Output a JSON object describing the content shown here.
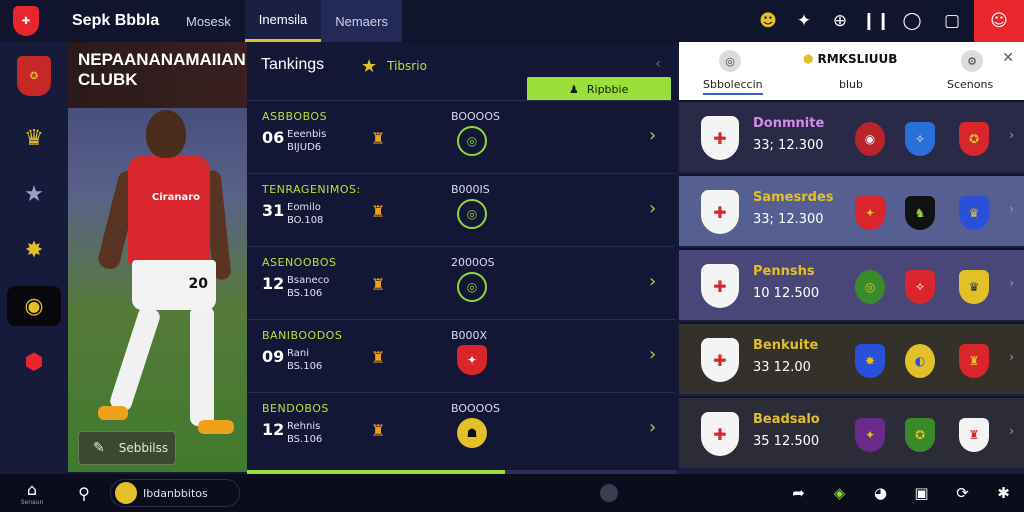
{
  "topbar": {
    "title": "Sepk Bbbla",
    "tabs": [
      {
        "label": "Mosesk"
      },
      {
        "label": "Inemsila"
      },
      {
        "label": "Nemaers"
      }
    ],
    "icons": [
      "smiley-icon",
      "pin-icon",
      "globe-icon",
      "pause-icon",
      "circle-icon",
      "square-icon",
      "profile-icon"
    ]
  },
  "rail": {
    "items": [
      "club-crest-icon",
      "trophy-icon",
      "star-icon",
      "badge-icon",
      "coin-icon",
      "shield-icon"
    ],
    "active_index": 4
  },
  "player": {
    "club_name": "NEPAANANAMAIIAN CLUBK",
    "shirt_sponsor": "Ciranaro",
    "shirt_number": "20",
    "button_label": "Sebbilss"
  },
  "rankings": {
    "title": "Tankings",
    "subtitle": "Tibsrio",
    "pill_label": "Ripbbie",
    "progress_fraction": 0.6,
    "rows": [
      {
        "name": "ASBBOBOS",
        "num": "06",
        "meta1": "Eeenbis",
        "meta2": "BIJUD6",
        "code": "BOOOOS",
        "crest": "green"
      },
      {
        "name": "TENRAGENIMOS:",
        "num": "31",
        "meta1": "Eomilo",
        "meta2": "BO.108",
        "code": "B000IS",
        "crest": "green"
      },
      {
        "name": "ASENOOBOS",
        "num": "12",
        "meta1": "Bsaneco",
        "meta2": "BS.106",
        "code": "2000OS",
        "crest": "green"
      },
      {
        "name": "BANIBOODOS",
        "num": "09",
        "meta1": "Rani",
        "meta2": "BS.106",
        "code": "B000X",
        "crest": "red"
      },
      {
        "name": "BENDOBOS",
        "num": "12",
        "meta1": "Rehnis",
        "meta2": "BS.106",
        "code": "BOOOOS",
        "crest": "yellow"
      }
    ]
  },
  "clubs": {
    "title": "RMKSLIUUB",
    "tabs": [
      {
        "label": "Sbboleccin"
      },
      {
        "label": "blub"
      },
      {
        "label": "Scenons"
      }
    ],
    "teams": [
      {
        "name": "Donmnite",
        "score": "33; 12.300",
        "name_color": "#d58be8"
      },
      {
        "name": "Samesrdes",
        "score": "33; 12.300",
        "name_color": "#e1c02a"
      },
      {
        "name": "Pennshs",
        "score": "10  12.500",
        "name_color": "#e1c02a"
      },
      {
        "name": "Benkuite",
        "score": "33  12.00",
        "name_color": "#e1c02a"
      },
      {
        "name": "Beadsalo",
        "score": "35  12.500",
        "name_color": "#e1c02a"
      }
    ]
  },
  "bottombar": {
    "home_label": "Senaun",
    "field_value": "Ibdanbbitos"
  },
  "colors": {
    "accent_green": "#9be03a",
    "accent_gold": "#e1c02a",
    "brand_red": "#e8262c",
    "panel_bg": "#131735"
  }
}
